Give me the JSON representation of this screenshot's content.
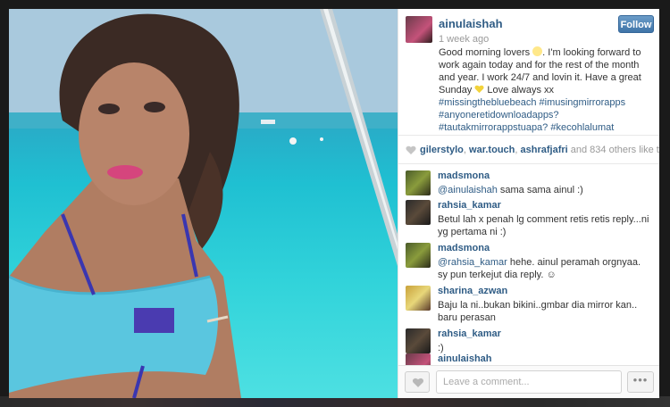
{
  "post": {
    "username": "ainulaishah",
    "time": "1 week ago",
    "follow_label": "Follow",
    "caption_a": "Good morning lovers ",
    "caption_b": ". I'm looking forward to work again today and for the rest of the month and year. I work 24/7 and lovin it. Have a great Sunday ",
    "caption_c": " Love always xx ",
    "hashtags": "#missingthebluebeach #imusingmirrorapps #anyoneretidownloadapps? #tautakmirrorappstuapa? #kecohlalumat"
  },
  "likes": {
    "names": [
      "gilerstylo",
      "war.touch",
      "ashrafjafri"
    ],
    "sep1": ", ",
    "sep2": ", ",
    "and_text": " and ",
    "count": "834",
    "suffix": " others like this."
  },
  "comments": [
    {
      "user": "madsmona",
      "mention": "@ainulaishah",
      "text": " sama sama ainul :)"
    },
    {
      "user": "rahsia_kamar",
      "mention": "",
      "text": "Betul lah x penah lg comment retis retis reply...ni yg pertama ni :)"
    },
    {
      "user": "madsmona",
      "mention": "@rahsia_kamar",
      "text": " hehe. ainul peramah orgnyaa. sy pun terkejut dia reply. ☺"
    },
    {
      "user": "sharina_azwan",
      "mention": "",
      "text": "Baju la ni..bukan bikini..gmbar dia mirror kan.. baru perasan"
    },
    {
      "user": "rahsia_kamar",
      "mention": "",
      "text": ":)"
    },
    {
      "user": "ainulaishah",
      "mention": "",
      "text": ""
    }
  ],
  "footer": {
    "comment_placeholder": "Leave a comment...",
    "more_label": "•••"
  },
  "icons": {
    "like": "heart-icon",
    "sun_emoji": "sun-emoji-icon",
    "heart_emoji": "yellow-heart-emoji-icon",
    "more": "ellipsis-icon"
  },
  "colors": {
    "link": "#2f5c85",
    "follow": "#4a7fb3",
    "sea": "#2ec9d6"
  }
}
